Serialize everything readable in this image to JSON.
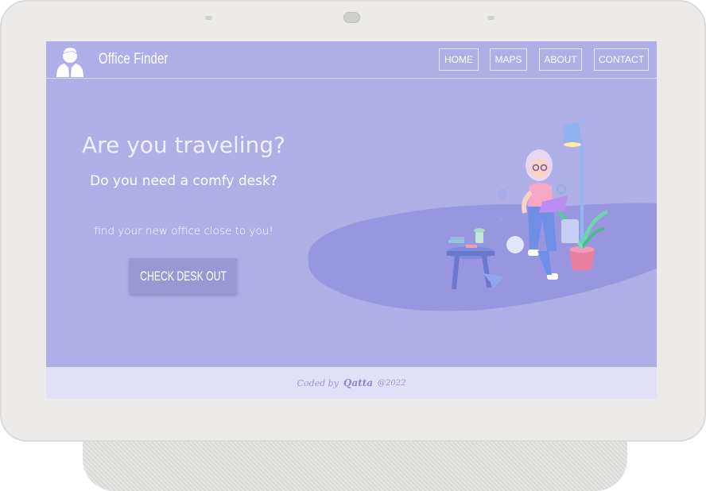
{
  "app": {
    "brand": "Office Finder"
  },
  "nav": {
    "items": [
      {
        "label": "HOME"
      },
      {
        "label": "MAPS"
      },
      {
        "label": "ABOUT"
      },
      {
        "label": "CONTACT"
      }
    ]
  },
  "hero": {
    "title": "Are you traveling?",
    "subtitle": "Do you need a comfy desk?",
    "text": "find your new office close to you!",
    "cta_label": "CHECK DESK OUT"
  },
  "footer": {
    "by": "Coded by",
    "author": "Qatta",
    "year": "@2022"
  },
  "colors": {
    "screen_bg": "#b0aee6",
    "footer_bg": "#e1e0f6",
    "button_bg": "#9a98d4",
    "device": "#ecebe9"
  },
  "icons": [
    "user-avatar-icon",
    "desk-icon"
  ]
}
